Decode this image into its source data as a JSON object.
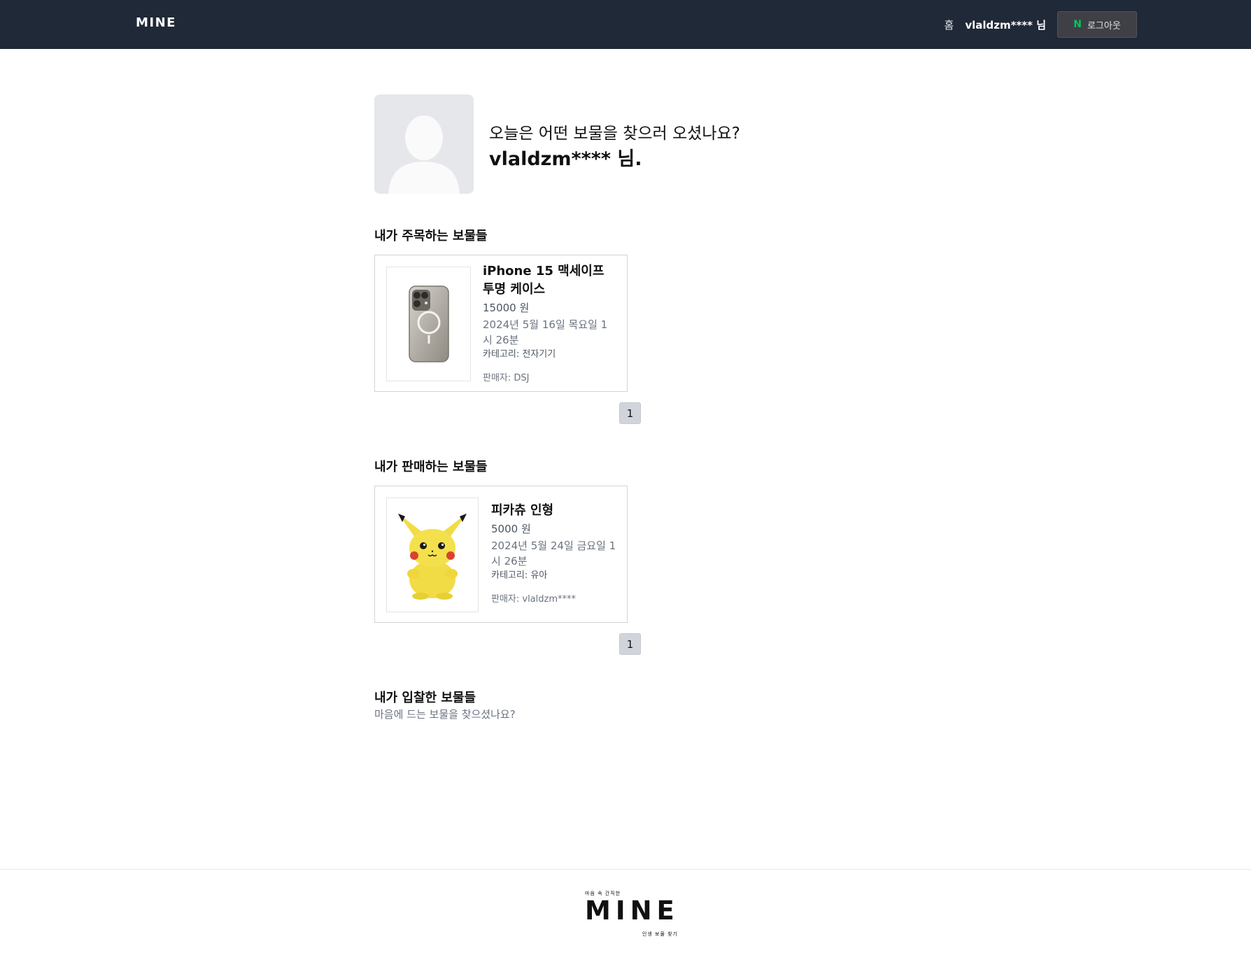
{
  "header": {
    "logo": "MINE",
    "home_link": "홈",
    "user_label": "vlaldzm**** 님",
    "naver_icon_letter": "N",
    "logout_label": "로그아웃"
  },
  "profile": {
    "greeting": "오늘은 어떤 보물을 찾으러 오셨나요?",
    "username": "vlaldzm**** 님."
  },
  "watching": {
    "title": "내가 주목하는 보물들",
    "items": [
      {
        "title": "iPhone 15 맥세이프 투명 케이스",
        "price": "15000 원",
        "date": "2024년 5월 16일 목요일 1시 26분",
        "category": "카테고리: 전자기기",
        "seller": "판매자: DSJ",
        "image_icon": "iphone-case-image"
      }
    ],
    "pages": [
      "1"
    ]
  },
  "selling": {
    "title": "내가 판매하는 보물들",
    "items": [
      {
        "title": "피카츄 인형",
        "price": "5000 원",
        "date": "2024년 5월 24일 금요일 1시 26분",
        "category": "카테고리: 유아",
        "seller": "판매자: vlaldzm****",
        "image_icon": "pikachu-doll-image"
      }
    ],
    "pages": [
      "1"
    ]
  },
  "bidding": {
    "title": "내가 입찰한 보물들",
    "empty_message": "마음에 드는 보물을 찾으셨나요?"
  },
  "footer": {
    "tag_top": "마음 속 간직한",
    "logo": "MINE",
    "tag_bottom": "인생 보물 찾기"
  },
  "colors": {
    "header_bg": "#1f2937",
    "naver_green": "#03c75a",
    "pagination_bg": "#d1d5db"
  }
}
